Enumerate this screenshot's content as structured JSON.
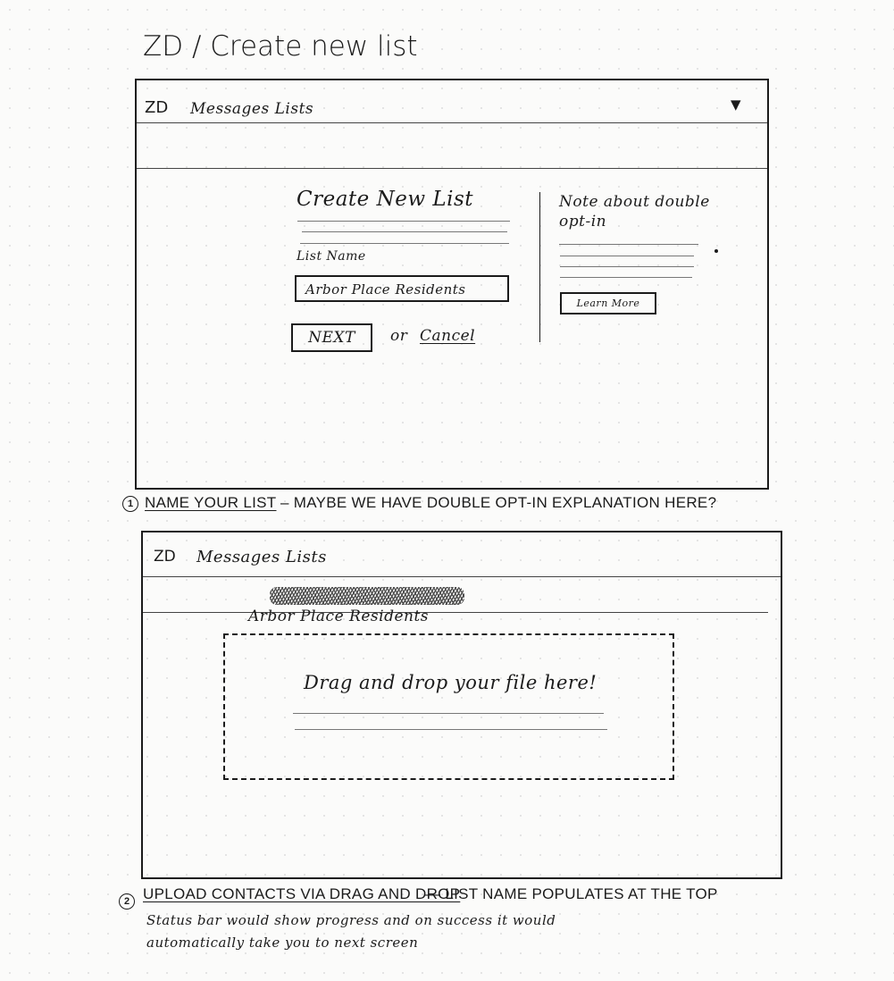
{
  "page_title": "ZD / Create new list",
  "screen1": {
    "header": {
      "logo": "ZD",
      "nav": "Messages Lists",
      "dropdown_icon": "triangle-down"
    },
    "form": {
      "heading": "Create New List",
      "field_label": "List Name",
      "field_value": "Arbor Place Residents",
      "next_label": "NEXT",
      "or_text": "or",
      "cancel_label": "Cancel"
    },
    "sidebar": {
      "note": "Note about double opt-in",
      "learn_more_label": "Learn More"
    },
    "caption_number": "1",
    "caption_title": "NAME YOUR LIST",
    "caption_text": "– MAYBE WE HAVE DOUBLE OPT-IN EXPLANATION HERE?"
  },
  "screen2": {
    "header": {
      "logo": "ZD",
      "nav": "Messages Lists"
    },
    "list_name": "Arbor Place Residents",
    "dropzone_text": "Drag and drop your file here!",
    "caption_number": "2",
    "caption_title": "UPLOAD CONTACTS VIA DRAG AND DROP",
    "caption_text": "— LIST NAME POPULATES AT THE TOP",
    "note_line1": "Status bar would show progress and on success it would",
    "note_line2": "automatically take you to next screen"
  }
}
